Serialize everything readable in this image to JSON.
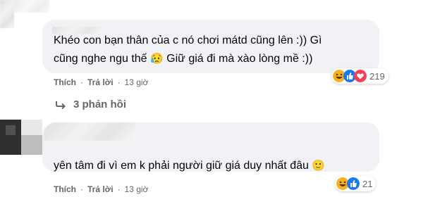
{
  "comment1": {
    "line1": "Khéo con bạn thân của c nó chơi mátd cũng lên :)) Gì",
    "line2_before": "cũng nghe ngu thế",
    "line2_after": "Giữ giá đi mà xào lòng mề :))",
    "emoji_sad": "😥",
    "actions": {
      "like": "Thích",
      "reply": "Trả lời",
      "time": "13 giờ"
    },
    "reaction_count": "219",
    "reaction_icons": [
      "haha-icon",
      "like-icon",
      "love-icon"
    ]
  },
  "view_replies": {
    "label": "3 phản hồi",
    "icon": "reply-arrow-icon"
  },
  "comment2": {
    "text_before": "yên tâm đi vì em k phải người giữ giá duy nhất đâu",
    "emoji_smile": "🙂",
    "actions": {
      "like": "Thích",
      "reply": "Trả lời",
      "time": "13 giờ"
    },
    "reaction_count": "21",
    "reaction_icons": [
      "haha-icon",
      "like-icon"
    ]
  },
  "colors": {
    "bubble": "#f0f2f5",
    "like_blue": "#1877f2",
    "love_red": "#f33e58",
    "haha_yellow": "#f7b125",
    "secondary_text": "#65676b"
  }
}
